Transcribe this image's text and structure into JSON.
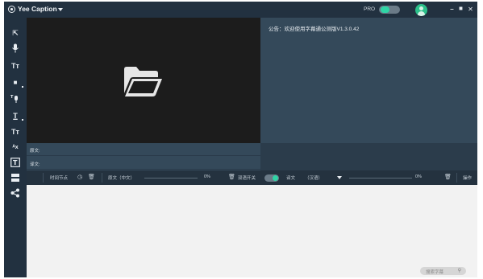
{
  "app": {
    "title": "Yee Caption"
  },
  "header": {
    "pro_label": "PRO",
    "pro_enabled": true,
    "minimize_glyph": "–",
    "maximize_glyph": "◼",
    "close_glyph": "✕"
  },
  "toolbar": {
    "tools": [
      {
        "name": "select-tool-icon",
        "glyph": "⇱"
      },
      {
        "name": "microphone-icon",
        "glyph": "🎙"
      },
      {
        "name": "text-tool-icon",
        "glyph": "Tт"
      },
      {
        "name": "block-tool-icon",
        "glyph": "■"
      },
      {
        "name": "voice-tool-icon",
        "glyph": "ᵀ⬤"
      },
      {
        "name": "text-underline-icon",
        "glyph": "T̲"
      },
      {
        "name": "text-format-icon",
        "glyph": "Tт"
      },
      {
        "name": "translate-icon",
        "glyph": "ᴬx"
      },
      {
        "name": "text-box-icon",
        "glyph": "T"
      },
      {
        "name": "layout-icon",
        "glyph": "▤"
      },
      {
        "name": "share-icon",
        "glyph": "⋖"
      }
    ]
  },
  "announcement": {
    "text": "公告：欢迎使用字幕通公测版V1.3.0.42"
  },
  "subtitle_rows": [
    {
      "label": "原文:"
    },
    {
      "label": "译文:"
    }
  ],
  "columns": {
    "timecode": "时间节点",
    "original": "原文（中文）",
    "original_progress": "0%",
    "dual_toggle_label": "双语开关",
    "dual_enabled": true,
    "translation": "译文",
    "translation_lang": "（汉语）",
    "translation_progress": "0%",
    "actions": "操作"
  },
  "search": {
    "label": "搜索字幕",
    "icon": "search-icon"
  },
  "colors": {
    "accent": "#2fd4a5",
    "panel": "#34495a",
    "chrome": "#223140",
    "video": "#1c1c1c"
  }
}
